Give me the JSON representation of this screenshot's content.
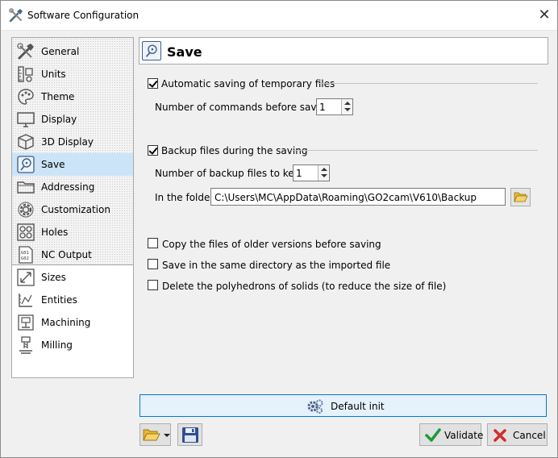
{
  "window": {
    "title": "Software Configuration"
  },
  "sidebar": {
    "items": [
      {
        "label": "General",
        "icon": "tools-icon"
      },
      {
        "label": "Units",
        "icon": "ruler-icon"
      },
      {
        "label": "Theme",
        "icon": "palette-icon"
      },
      {
        "label": "Display",
        "icon": "monitor-icon"
      },
      {
        "label": "3D Display",
        "icon": "cube-icon"
      },
      {
        "label": "Save",
        "icon": "save-disk-icon",
        "selected": true
      },
      {
        "label": "Addressing",
        "icon": "folder-icon"
      },
      {
        "label": "Customization",
        "icon": "gear-icon"
      },
      {
        "label": "Holes",
        "icon": "holes-icon"
      },
      {
        "label": "NC Output",
        "icon": "nc-file-icon"
      },
      {
        "label": "Sizes",
        "icon": "dimension-icon"
      },
      {
        "label": "Entities",
        "icon": "entities-icon"
      },
      {
        "label": "Machining",
        "icon": "machining-icon"
      },
      {
        "label": "Milling",
        "icon": "milling-icon"
      }
    ]
  },
  "panel": {
    "title": "Save",
    "auto_save": {
      "label": "Automatic saving of temporary files",
      "checked": true
    },
    "commands_before_saving": {
      "label": "Number of commands before saving",
      "value": "1"
    },
    "backup": {
      "label": "Backup files during the saving",
      "checked": true
    },
    "backup_count": {
      "label": "Number of backup files to keep",
      "value": "1"
    },
    "folder": {
      "label": "In the folder",
      "value": "C:\\Users\\MC\\AppData\\Roaming\\GO2cam\\V610\\Backup"
    },
    "options": [
      {
        "label": "Copy the files of older versions before saving",
        "checked": false
      },
      {
        "label": "Save in the same directory as the imported file",
        "checked": false
      },
      {
        "label": "Delete the polyhedrons of solids (to reduce the size of file)",
        "checked": false
      }
    ]
  },
  "footer": {
    "default_init": "Default init",
    "validate": "Validate",
    "cancel": "Cancel"
  },
  "colors": {
    "selected_bg": "#cce4f7",
    "accent_border": "#0078d7",
    "validate_green": "#1e9c3c",
    "cancel_red": "#d22b2b"
  }
}
